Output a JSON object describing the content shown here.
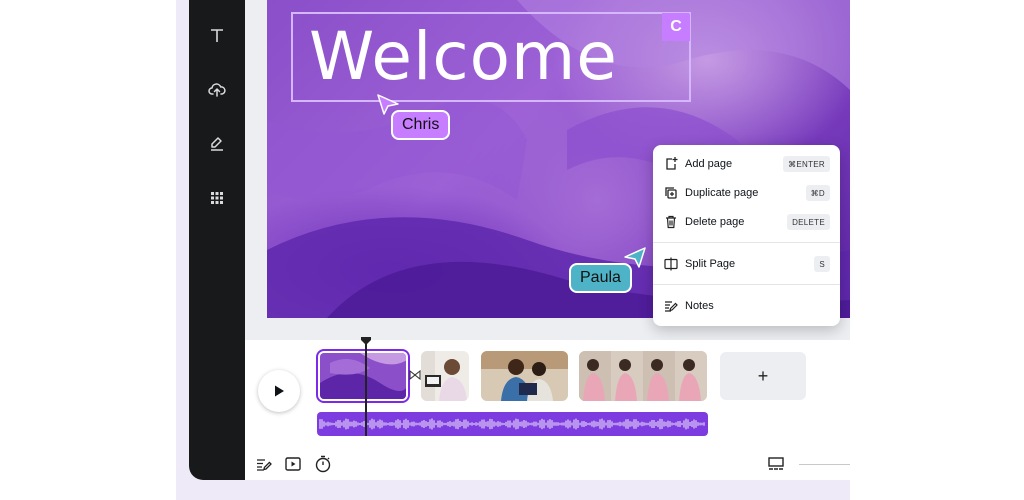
{
  "canvas": {
    "headline": "Welcome",
    "collaborator_badge": "C",
    "cursors": [
      {
        "name": "Chris",
        "color": "#c77dff"
      },
      {
        "name": "Paula",
        "color": "#4fb3c8"
      }
    ]
  },
  "context_menu": {
    "items": [
      {
        "label": "Add page",
        "shortcut": "⌘ENTER",
        "icon": "add-page-icon"
      },
      {
        "label": "Duplicate page",
        "shortcut": "⌘D",
        "icon": "duplicate-page-icon"
      },
      {
        "label": "Delete page",
        "shortcut": "DELETE",
        "icon": "trash-icon"
      },
      {
        "label": "Split Page",
        "shortcut": "S",
        "icon": "split-page-icon"
      },
      {
        "label": "Notes",
        "shortcut": "",
        "icon": "notes-icon"
      }
    ]
  },
  "sidebar": {
    "items": [
      "text-icon",
      "upload-cloud-icon",
      "draw-icon",
      "apps-grid-icon"
    ]
  },
  "timeline": {
    "add_label": "+",
    "transition_icon": "bowtie-transition-icon"
  },
  "colors": {
    "accent_purple": "#7d3ce0",
    "sidebar_bg": "#18191b",
    "selection_border": "#d6b7ff"
  }
}
